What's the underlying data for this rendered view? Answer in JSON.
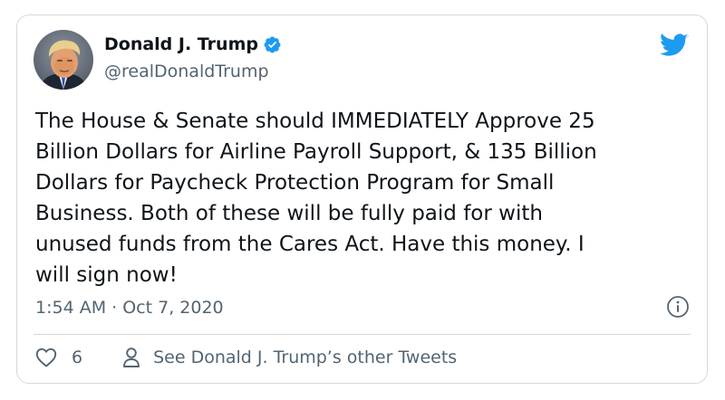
{
  "author": {
    "display_name": "Donald J. Trump",
    "handle": "@realDonaldTrump",
    "verified": true
  },
  "tweet": {
    "text": "The House & Senate should IMMEDIATELY Approve 25\nBillion Dollars for Airline Payroll Support, & 135 Billion\nDollars for Paycheck Protection Program for Small\nBusiness. Both of these will be fully paid for with\nunused funds from the Cares Act. Have this money. I\nwill sign now!",
    "timestamp": "1:54 AM · Oct 7, 2020"
  },
  "actions": {
    "like_count": "6",
    "other_tweets_label": "See Donald J. Trump’s other Tweets"
  },
  "colors": {
    "twitter_blue": "#1d9bf0",
    "secondary_text": "#536471",
    "border": "#cfd9de"
  },
  "icons": {
    "brand": "twitter-bird-icon",
    "verified": "verified-badge-icon",
    "info": "info-icon",
    "like": "heart-icon",
    "profile": "person-icon"
  }
}
